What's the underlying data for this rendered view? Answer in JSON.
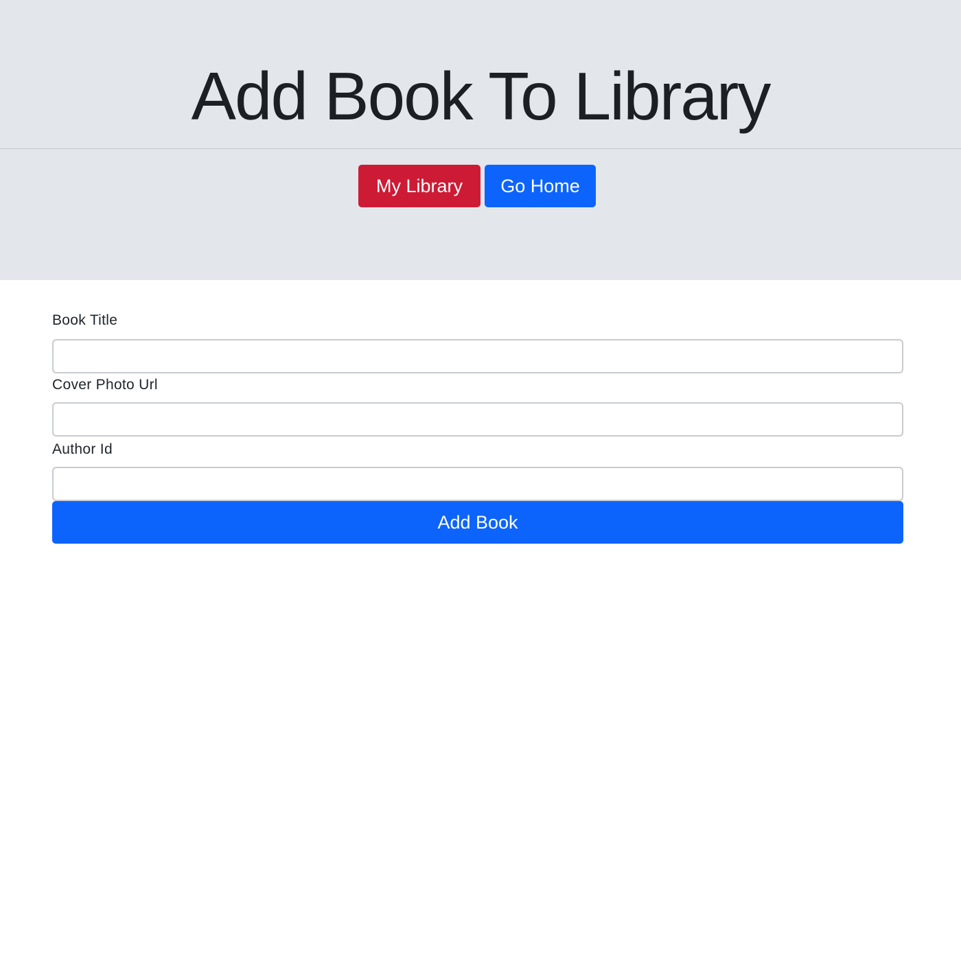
{
  "header": {
    "title": "Add Book To Library",
    "nav": {
      "my_library_label": "My Library",
      "go_home_label": "Go Home"
    }
  },
  "form": {
    "fields": [
      {
        "label": "Book Title",
        "value": "",
        "placeholder": ""
      },
      {
        "label": "Cover Photo Url",
        "value": "",
        "placeholder": ""
      },
      {
        "label": "Author Id",
        "value": "",
        "placeholder": ""
      }
    ],
    "submit_label": "Add Book"
  },
  "colors": {
    "header_background": "#e3e7ec",
    "danger": "#cd1b36",
    "primary": "#0d64fd",
    "input_border": "#c7cbd1",
    "text": "#212529"
  }
}
